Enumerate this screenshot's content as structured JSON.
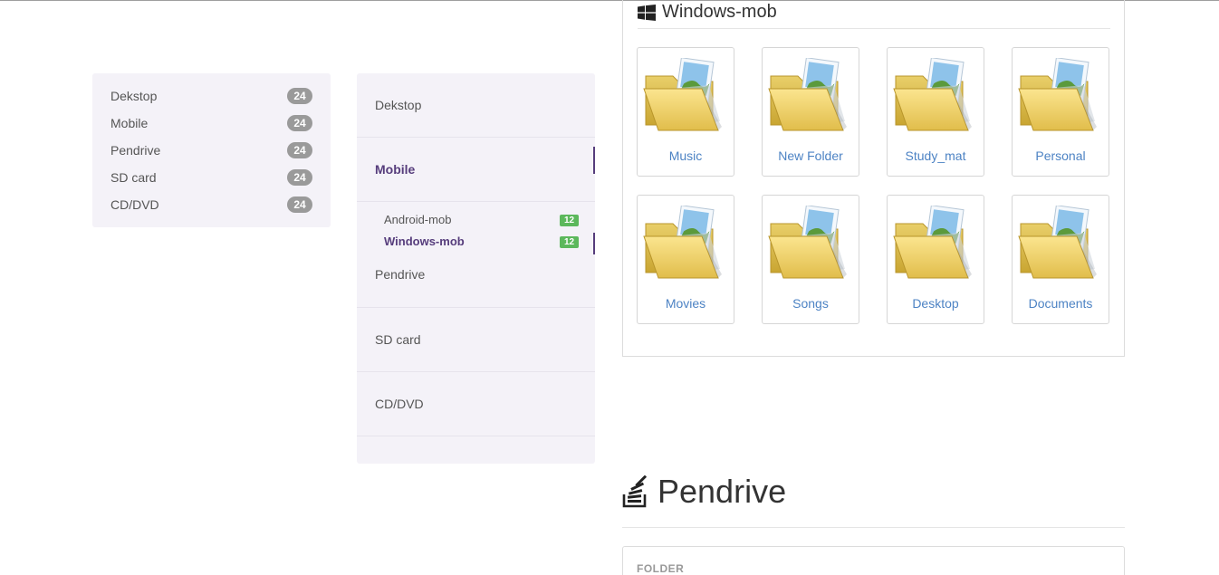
{
  "left_panel": {
    "items": [
      {
        "label": "Dekstop",
        "count": "24"
      },
      {
        "label": "Mobile",
        "count": "24"
      },
      {
        "label": "Pendrive",
        "count": "24"
      },
      {
        "label": "SD card",
        "count": "24"
      },
      {
        "label": "CD/DVD",
        "count": "24"
      }
    ]
  },
  "side_nav": {
    "items": [
      "Dekstop",
      "Mobile",
      "Pendrive",
      "SD card",
      "CD/DVD"
    ],
    "active": "Mobile",
    "sub_items": [
      {
        "label": "Android-mob",
        "count": "12"
      },
      {
        "label": "Windows-mob",
        "count": "12"
      }
    ],
    "active_sub": "Windows-mob"
  },
  "folder_section": {
    "title": "Windows-mob",
    "title_icon": "windows-icon",
    "folders": [
      "Music",
      "New Folder",
      "Study_mat",
      "Personal",
      "Movies",
      "Songs",
      "Desktop",
      "Documents"
    ]
  },
  "pendrive_section": {
    "title": "Pendrive",
    "title_icon": "stack-icon",
    "caption": "FOLDER"
  },
  "colors": {
    "accent": "#563d7c",
    "link": "#4d83c4",
    "badge_gray": "#9a9a9a",
    "badge_green": "#5cb85c",
    "panel_bg": "#f4f2f8"
  }
}
